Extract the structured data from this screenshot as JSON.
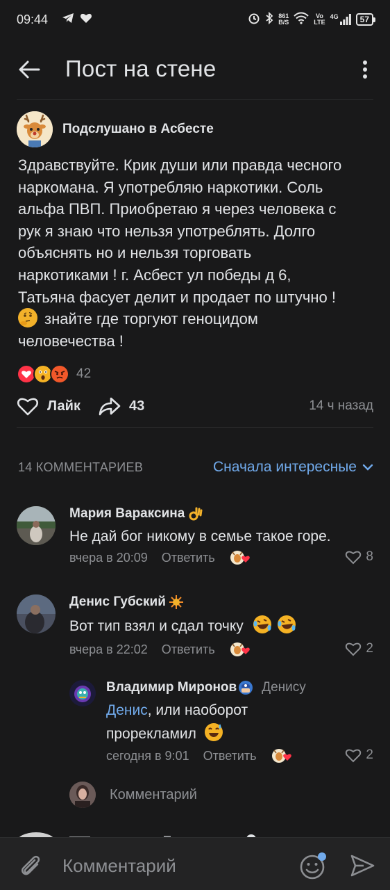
{
  "status_bar": {
    "time": "09:44",
    "net_speed_top": "861",
    "net_speed_bottom": "B/S",
    "volte_top": "Vo",
    "volte_bottom": "LTE",
    "network": "4G",
    "battery": "57"
  },
  "header": {
    "title": "Пост на стене"
  },
  "post": {
    "author": "Подслушано в Асбесте",
    "text_lines": [
      "Здравствуйте. Крик души или правда чесного",
      "наркомана. Я употребляю наркотики. Соль",
      "альфа ПВП. Приобретаю я через  человека с",
      "рук я знаю что нельзя употреблять. Долго",
      "объяснять но и нельзя торговать",
      "наркотиками ! г. Асбест ул победы д 6,",
      "Татьяна  фасует  делит и продает по штучно !",
      "знайте где торгуют геноцидом",
      "человечества !"
    ],
    "reactions_count": "42",
    "like_label": "Лайк",
    "share_count": "43",
    "time": "14 ч назад"
  },
  "comments_section": {
    "count_label": "14 КОММЕНТАРИЕВ",
    "sort_label": "Сначала интересные",
    "comments": [
      {
        "author": "Мария Вараксина",
        "text": "Не дай бог никому в семье такое горе.",
        "time": "вчера в 20:09",
        "reply_label": "Ответить",
        "likes": "8"
      },
      {
        "author": "Денис Губский",
        "text": "Вот тип взял и сдал точку",
        "time": "вчера в 22:02",
        "reply_label": "Ответить",
        "likes": "2"
      },
      {
        "author": "Владимир Миронов",
        "reply_to": "Денису",
        "mention": "Денис",
        "text_after_mention": ", или наоборот",
        "text_line2": "прорекламил",
        "time": "сегодня в 9:01",
        "reply_label": "Ответить",
        "likes": "2"
      }
    ],
    "reply_placeholder": "Комментарий"
  },
  "bottom_bar": {
    "placeholder": "Комментарий"
  },
  "colors": {
    "background": "#19191a",
    "accent": "#71aaeb",
    "secondary_text": "#8d8f93"
  }
}
